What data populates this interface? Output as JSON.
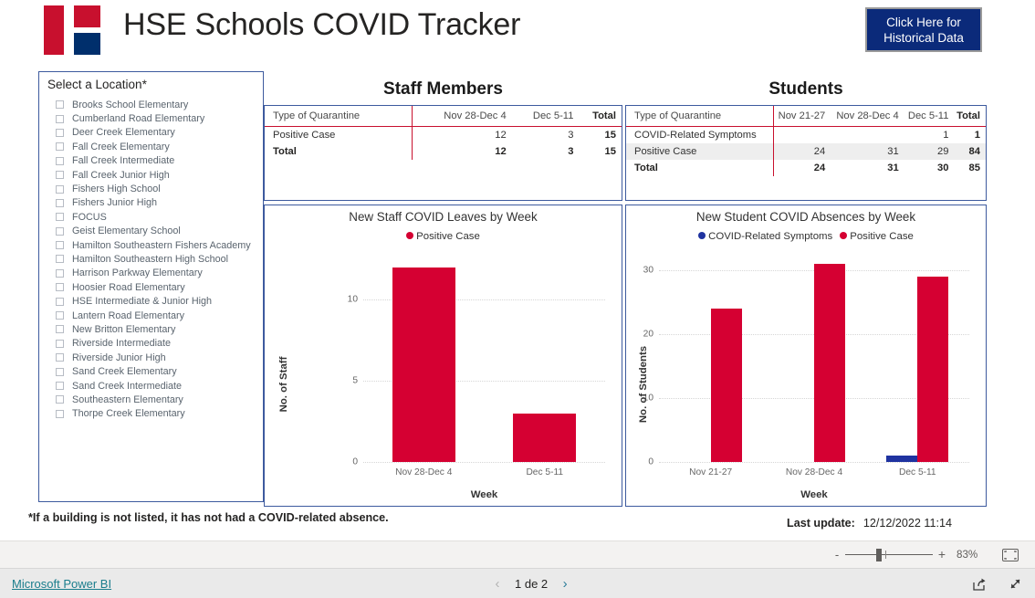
{
  "header": {
    "title": "HSE Schools COVID Tracker",
    "logo_colors": {
      "red": "#C8102E",
      "navy": "#002F6C"
    },
    "historical_button": "Click Here for\nHistorical Data",
    "historical_button_line1": "Click Here for",
    "historical_button_line2": "Historical Data"
  },
  "slicer": {
    "title": "Select a Location*",
    "items": [
      {
        "label": "Brooks School Elementary",
        "checked": false
      },
      {
        "label": "Cumberland Road Elementary",
        "checked": false
      },
      {
        "label": "Deer Creek Elementary",
        "checked": false
      },
      {
        "label": "Fall Creek Elementary",
        "checked": false
      },
      {
        "label": "Fall Creek Intermediate",
        "checked": false
      },
      {
        "label": "Fall Creek Junior High",
        "checked": false
      },
      {
        "label": "Fishers High School",
        "checked": false
      },
      {
        "label": "Fishers Junior High",
        "checked": false
      },
      {
        "label": "FOCUS",
        "checked": false
      },
      {
        "label": "Geist Elementary School",
        "checked": false
      },
      {
        "label": "Hamilton Southeastern Fishers Academy",
        "checked": false
      },
      {
        "label": "Hamilton Southeastern High School",
        "checked": false
      },
      {
        "label": "Harrison Parkway Elementary",
        "checked": false
      },
      {
        "label": "Hoosier Road Elementary",
        "checked": false
      },
      {
        "label": "HSE Intermediate & Junior High",
        "checked": false
      },
      {
        "label": "Lantern Road Elementary",
        "checked": false
      },
      {
        "label": "New Britton Elementary",
        "checked": false
      },
      {
        "label": "Riverside Intermediate",
        "checked": false
      },
      {
        "label": "Riverside Junior High",
        "checked": false
      },
      {
        "label": "Sand Creek Elementary",
        "checked": false
      },
      {
        "label": "Sand Creek Intermediate",
        "checked": false
      },
      {
        "label": "Southeastern Elementary",
        "checked": false
      },
      {
        "label": "Thorpe Creek Elementary",
        "checked": false
      }
    ]
  },
  "staff": {
    "panel_title": "Staff Members",
    "table": {
      "headers": [
        "Type of Quarantine",
        "Nov 28-Dec 4",
        "Dec 5-11",
        "Total"
      ],
      "rows": [
        {
          "label": "Positive Case",
          "values": [
            "12",
            "3",
            "15"
          ],
          "bold": false,
          "band": false
        },
        {
          "label": "Total",
          "values": [
            "12",
            "3",
            "15"
          ],
          "bold": true,
          "band": false
        }
      ]
    }
  },
  "students": {
    "panel_title": "Students",
    "table": {
      "headers": [
        "Type of Quarantine",
        "Nov 21-27",
        "Nov 28-Dec 4",
        "Dec 5-11",
        "Total"
      ],
      "rows": [
        {
          "label": "COVID-Related Symptoms",
          "values": [
            "",
            "",
            "1",
            "1"
          ],
          "bold": false,
          "band": false
        },
        {
          "label": "Positive Case",
          "values": [
            "24",
            "31",
            "29",
            "84"
          ],
          "bold": false,
          "band": true
        },
        {
          "label": "Total",
          "values": [
            "24",
            "31",
            "30",
            "85"
          ],
          "bold": true,
          "band": false
        }
      ]
    }
  },
  "chart_data": [
    {
      "id": "staff-chart",
      "type": "bar",
      "title": "New Staff COVID Leaves by Week",
      "xlabel": "Week",
      "ylabel": "No. of Staff",
      "categories": [
        "Nov 28-Dec 4",
        "Dec 5-11"
      ],
      "yticks": [
        "0",
        "5",
        "10"
      ],
      "ytick_values": [
        0,
        5,
        10
      ],
      "ylim": [
        0,
        13
      ],
      "grid": true,
      "legend_position": "top",
      "series": [
        {
          "name": "Positive Case",
          "color": "#D50032",
          "values": [
            12,
            3
          ]
        }
      ]
    },
    {
      "id": "student-chart",
      "type": "bar",
      "title": "New Student COVID Absences by Week",
      "xlabel": "Week",
      "ylabel": "No. of Students",
      "categories": [
        "Nov 21-27",
        "Nov 28-Dec 4",
        "Dec 5-11"
      ],
      "yticks": [
        "0",
        "10",
        "20",
        "30"
      ],
      "ytick_values": [
        0,
        10,
        20,
        30
      ],
      "ylim": [
        0,
        33
      ],
      "grid": true,
      "legend_position": "top",
      "series": [
        {
          "name": "COVID-Related Symptoms",
          "color": "#1F33A0",
          "values": [
            0,
            0,
            1
          ]
        },
        {
          "name": "Positive Case",
          "color": "#D50032",
          "values": [
            24,
            31,
            29
          ]
        }
      ]
    }
  ],
  "footnote": "*If a building is not listed, it has not had a COVID-related absence.",
  "last_update": {
    "label": "Last update:",
    "value": "12/12/2022 11:14"
  },
  "zoombar": {
    "minus": "-",
    "plus": "+",
    "percent": "83%"
  },
  "statusbar": {
    "brand_link": "Microsoft Power BI",
    "page_label": "1 de 2",
    "prev_glyph": "‹",
    "next_glyph": "›"
  }
}
